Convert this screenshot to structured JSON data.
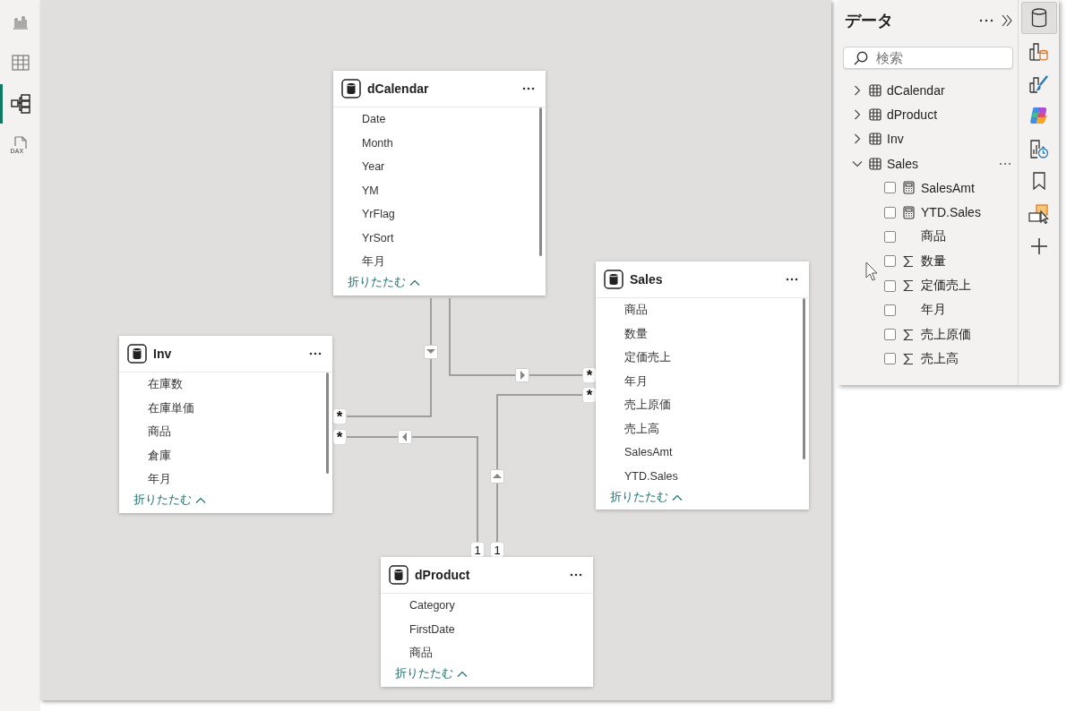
{
  "left_rail": {
    "items": [
      {
        "kind": "report",
        "selected": false
      },
      {
        "kind": "table",
        "selected": false
      },
      {
        "kind": "model",
        "selected": true
      },
      {
        "kind": "dax",
        "selected": false,
        "label": "DAX"
      }
    ]
  },
  "diagram": {
    "tables": [
      {
        "name": "dCalendar",
        "fields": [
          "Date",
          "Month",
          "Year",
          "YM",
          "YrFlag",
          "YrSort",
          "年月"
        ],
        "collapse": "折りたたむ",
        "scrollbar": true
      },
      {
        "name": "Inv",
        "fields": [
          "在庫数",
          "在庫単価",
          "商品",
          "倉庫",
          "年月"
        ],
        "collapse": "折りたたむ",
        "scrollbar": true
      },
      {
        "name": "Sales",
        "fields": [
          "商品",
          "数量",
          "定価売上",
          "年月",
          "売上原価",
          "売上高",
          "SalesAmt",
          "YTD.Sales"
        ],
        "collapse": "折りたたむ",
        "scrollbar": true
      },
      {
        "name": "dProduct",
        "fields": [
          "Category",
          "FirstDate",
          "商品"
        ],
        "collapse": "折りたたむ",
        "scrollbar": false
      }
    ],
    "relationships": [
      {
        "many_label": "*",
        "kind": "down"
      },
      {
        "many_label": "*",
        "kind": "right"
      },
      {
        "many_label": "*",
        "one_label": "1",
        "kind": "left"
      },
      {
        "many_label": "*",
        "one_label": "1",
        "kind": "up"
      }
    ]
  },
  "data_pane": {
    "title": "データ",
    "search": {
      "placeholder": "検索"
    },
    "tables": [
      {
        "name": "dCalendar",
        "expanded": false
      },
      {
        "name": "dProduct",
        "expanded": false
      },
      {
        "name": "Inv",
        "expanded": false
      },
      {
        "name": "Sales",
        "expanded": true,
        "fields": [
          {
            "name": "SalesAmt",
            "kind": "measure",
            "checked": false
          },
          {
            "name": "YTD.Sales",
            "kind": "measure",
            "checked": false
          },
          {
            "name": "商品",
            "kind": "text",
            "checked": false
          },
          {
            "name": "数量",
            "kind": "sum",
            "checked": false
          },
          {
            "name": "定価売上",
            "kind": "sum",
            "checked": false
          },
          {
            "name": "年月",
            "kind": "text",
            "checked": false
          },
          {
            "name": "売上原価",
            "kind": "sum",
            "checked": false
          },
          {
            "name": "売上高",
            "kind": "sum",
            "checked": false
          }
        ]
      }
    ]
  },
  "right_rail": {
    "items": [
      {
        "kind": "data",
        "selected": true
      },
      {
        "kind": "build",
        "selected": false
      },
      {
        "kind": "format",
        "selected": false
      },
      {
        "kind": "copilot",
        "selected": false
      },
      {
        "kind": "performance",
        "selected": false
      },
      {
        "kind": "bookmark",
        "selected": false
      },
      {
        "kind": "selection",
        "selected": false
      },
      {
        "kind": "add",
        "selected": false
      }
    ]
  }
}
